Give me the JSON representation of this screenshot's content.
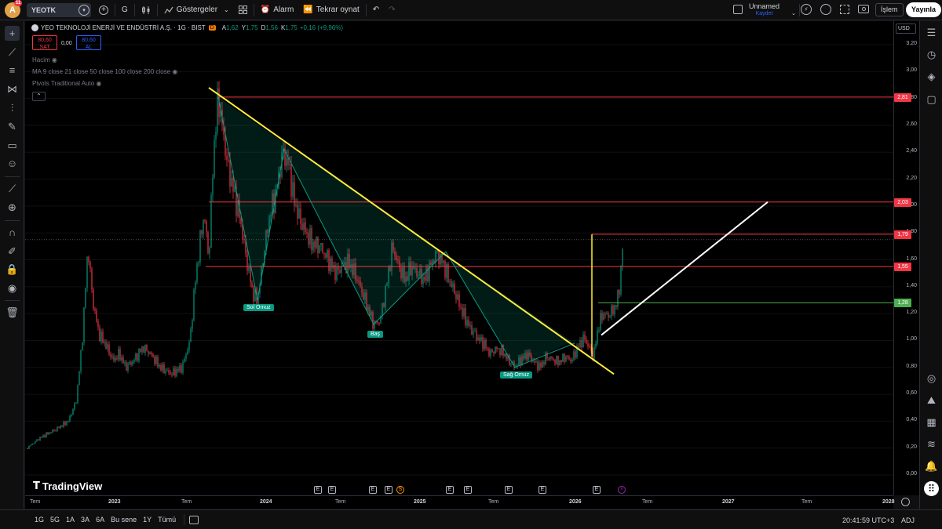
{
  "header": {
    "avatar_letter": "A",
    "avatar_badge": "11",
    "symbol": "YEOTK",
    "interval": "G",
    "indicators_label": "Göstergeler",
    "alarm_label": "Alarm",
    "replay_label": "Tekrar oynat",
    "layout_name": "Unnamed",
    "layout_status": "Kaydet",
    "trade_label": "İşlem",
    "publish_label": "Yayınla"
  },
  "legend": {
    "title": "YEO TEKNOLOJİ ENERJİ VE ENDÜSTRİ A.Ş. · 1G · BIST",
    "badge": "D",
    "ohlc": [
      {
        "k": "A",
        "v": "1,62"
      },
      {
        "k": "Y",
        "v": "1,75"
      },
      {
        "k": "D",
        "v": "1,56"
      },
      {
        "k": "K",
        "v": "1,75"
      }
    ],
    "change": "+0,16 (+9,96%)",
    "sell_price": "80,60",
    "sell_label": "SAT",
    "spread": "0,00",
    "buy_price": "80,60",
    "buy_label": "AL",
    "indicators": [
      "Hacim",
      "MA 9 close 21 close 50 close 100 close 200 close",
      "Pivots Traditional Auto"
    ]
  },
  "price_axis": {
    "currency": "USD",
    "ticks": [
      "3,20",
      "3,00",
      "2,80",
      "2,60",
      "2,40",
      "2,20",
      "2,00",
      "1,80",
      "1,60",
      "1,40",
      "1,20",
      "1,00",
      "0,80",
      "0,60",
      "0,40",
      "0,20",
      "0,00"
    ],
    "labels": [
      {
        "v": "2,81",
        "color": "#f23645"
      },
      {
        "v": "2,03",
        "color": "#f23645"
      },
      {
        "v": "1,79",
        "color": "#f23645"
      },
      {
        "v": "1,55",
        "color": "#f23645"
      },
      {
        "v": "1,28",
        "color": "#4caf50"
      }
    ]
  },
  "time_axis": {
    "ticks": [
      "Tem",
      "2023",
      "Tem",
      "2024",
      "Tem",
      "2025",
      "Tem",
      "2026",
      "Tem",
      "2027",
      "Tem",
      "2028"
    ]
  },
  "chart": {
    "watermark": "TradingView",
    "pattern_labels": [
      "Sol Omuz",
      "Baş",
      "Sağ Omuz"
    ],
    "events": [
      "E",
      "E",
      "E",
      "E",
      "S",
      "E",
      "E",
      "E",
      "E",
      "E"
    ]
  },
  "bottom": {
    "ranges": [
      "1G",
      "5G",
      "1A",
      "3A",
      "6A",
      "Bu sene",
      "1Y",
      "Tümü"
    ],
    "clock": "20:41:59 UTC+3",
    "adj": "ADJ"
  },
  "colors": {
    "bull": "#089981",
    "bear": "#f23645",
    "trendline": "#ffeb3b",
    "accent": "#2962ff"
  }
}
